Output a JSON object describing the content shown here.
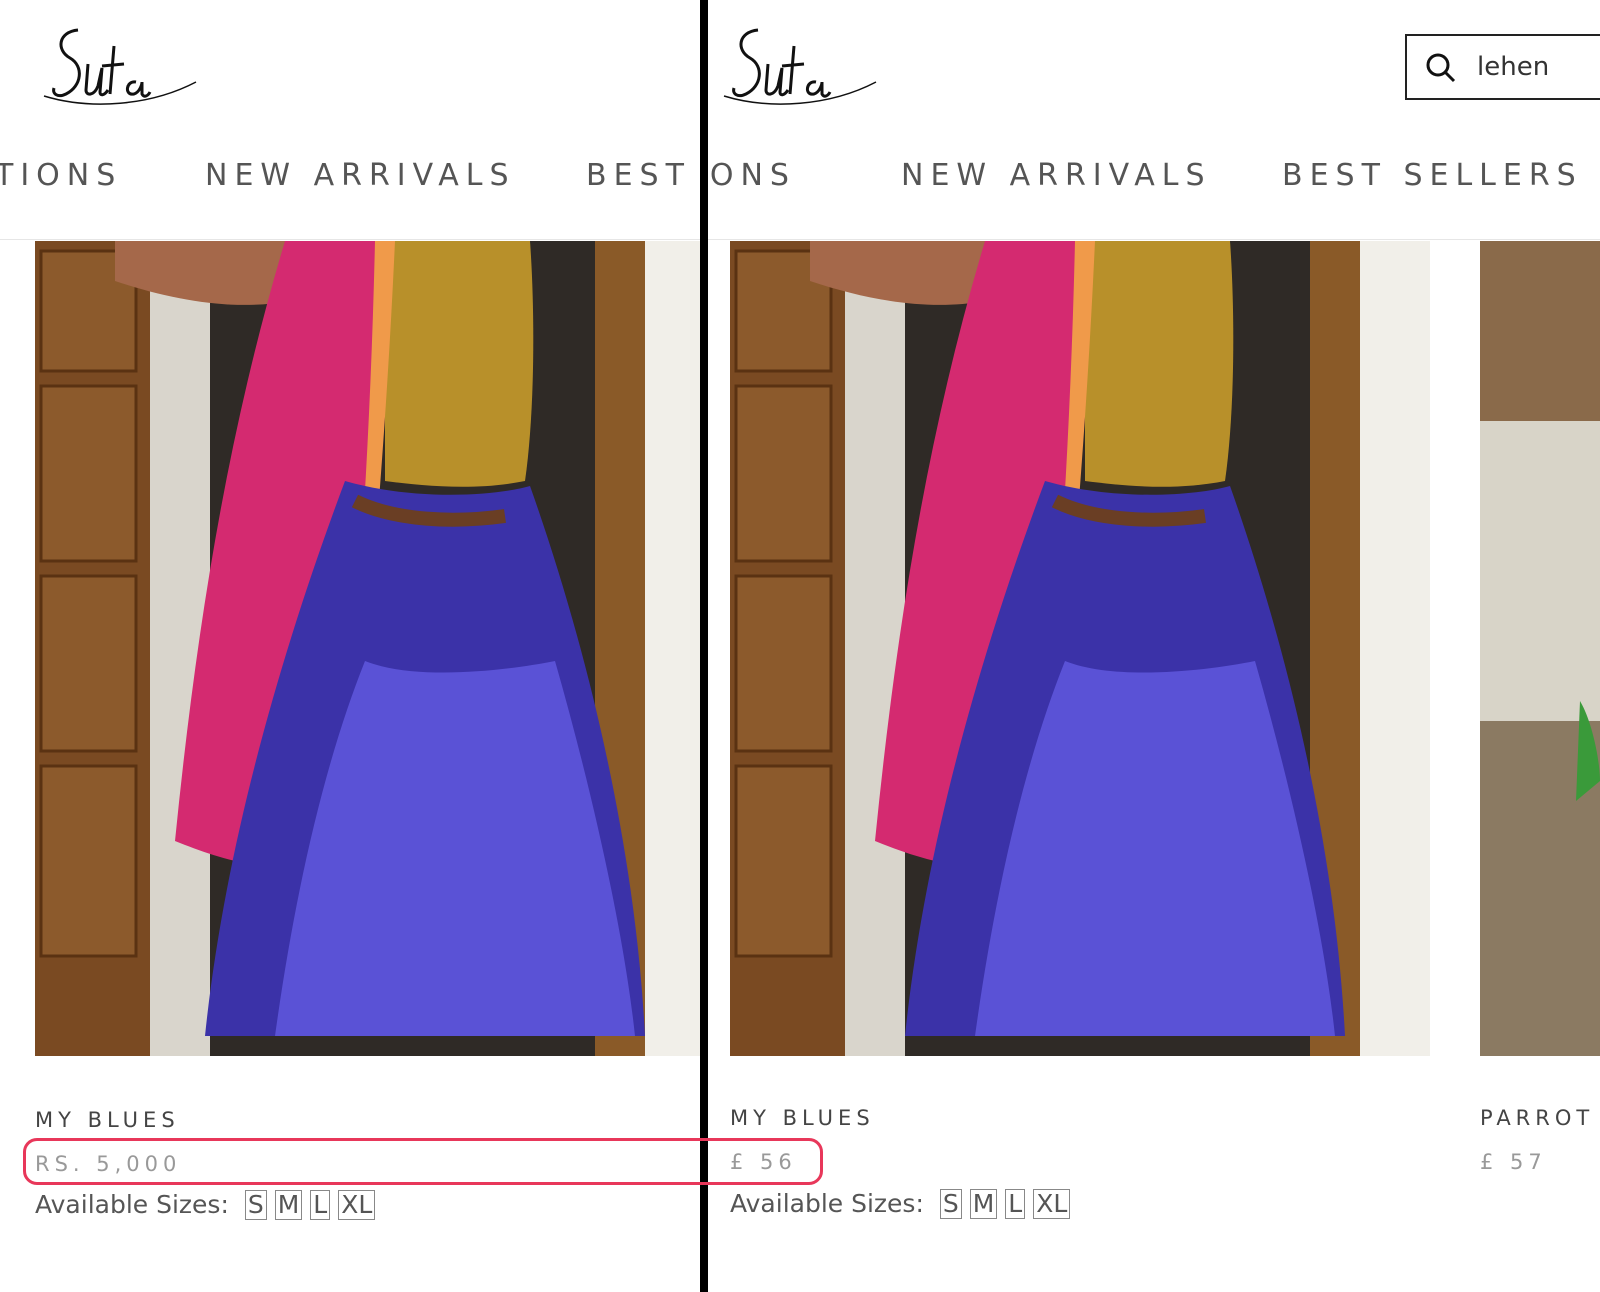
{
  "left": {
    "nav": [
      "TIONS",
      "NEW ARRIVALS",
      "BEST"
    ],
    "product": {
      "title": "MY BLUES",
      "price": "RS. 5,000",
      "sizes_label": "Available Sizes:",
      "sizes": [
        "S",
        "M",
        "L",
        "XL"
      ]
    }
  },
  "right": {
    "nav": [
      "IONS",
      "NEW ARRIVALS",
      "BEST SELLERS"
    ],
    "search": {
      "value": "lehen"
    },
    "product": {
      "title": "MY BLUES",
      "price": "£ 56",
      "sizes_label": "Available Sizes:",
      "sizes": [
        "S",
        "M",
        "L",
        "XL"
      ]
    },
    "next_product": {
      "title": "PARROT",
      "price": "£ 57"
    }
  },
  "colors": {
    "highlight": "#e8375a",
    "divider": "#000000"
  }
}
